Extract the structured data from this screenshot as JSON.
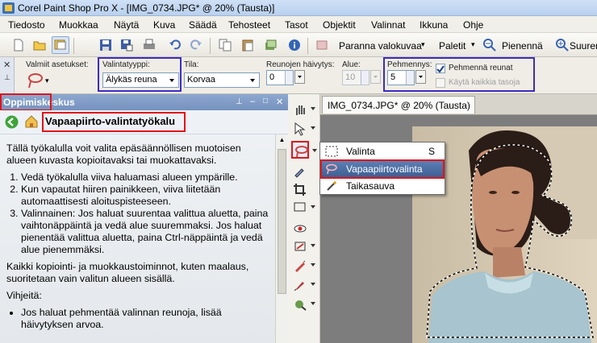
{
  "window": {
    "title": "Corel Paint Shop Pro X - [IMG_0734.JPG* @  20% (Tausta)]"
  },
  "menu": {
    "items": [
      "Tiedosto",
      "Muokkaa",
      "Näytä",
      "Kuva",
      "Säädä",
      "Tehosteet",
      "Tasot",
      "Objektit",
      "Valinnat",
      "Ikkuna",
      "Ohje"
    ]
  },
  "toolbar": {
    "enhance_label": "Paranna valokuvaa",
    "palettes_label": "Paletit",
    "zoom_label": "Pienennä",
    "zoom_in_label": "Suuren"
  },
  "options": {
    "presets_label": "Valmiit asetukset:",
    "selection_type_label": "Valintatyyppi:",
    "selection_type_value": "Älykäs reuna",
    "mode_label": "Tila:",
    "mode_value": "Korvaa",
    "feather_label": "Reunojen häivytys:",
    "feather_value": "0",
    "range_label": "Alue:",
    "range_value": "10",
    "smoothing_label": "Pehmennys:",
    "smoothing_value": "5",
    "antialias_label": "Pehmennä reunat",
    "antialias_checked": true,
    "all_layers_label": "Käytä kaikkia tasoja",
    "all_layers_checked": false
  },
  "learning_center": {
    "header": "Oppimiskeskus",
    "tool_title": "Vapaapiirto-valintatyökalu",
    "intro": "Tällä työkalulla voit valita epäsäännöllisen muotoisen alueen kuvasta kopioitavaksi tai muokattavaksi.",
    "steps": [
      "Vedä työkalulla viiva haluamasi alueen ympärille.",
      "Kun vapautat hiiren painikkeen, viiva liitetään automaattisesti aloituspisteeseen.",
      "Valinnainen: Jos haluat suurentaa valittua aluetta, paina vaihtonäppäintä ja vedä alue suuremmaksi. Jos haluat pienentää valittua aluetta, paina Ctrl-näppäintä ja vedä alue pienemmäksi."
    ],
    "note": "Kaikki kopiointi- ja muokkaustoiminnot, kuten maalaus, suoritetaan vain valitun alueen sisällä.",
    "tips_heading": "Vihjeitä:",
    "tips": [
      "Jos haluat pehmentää valinnan reunoja, lisää häivytyksen arvoa."
    ]
  },
  "image_window": {
    "tab_title": "IMG_0734.JPG* @  20% (Tausta)"
  },
  "flyout": {
    "items": [
      {
        "label": "Valinta",
        "shortcut": "S"
      },
      {
        "label": "Vapaapiirtovalinta",
        "shortcut": ""
      },
      {
        "label": "Taikasauva",
        "shortcut": ""
      }
    ],
    "selected_index": 1
  },
  "colors": {
    "annotation_red": "#e0141a",
    "annotation_blue": "#3d2bc4",
    "selected_item": "#4a6ca3"
  }
}
